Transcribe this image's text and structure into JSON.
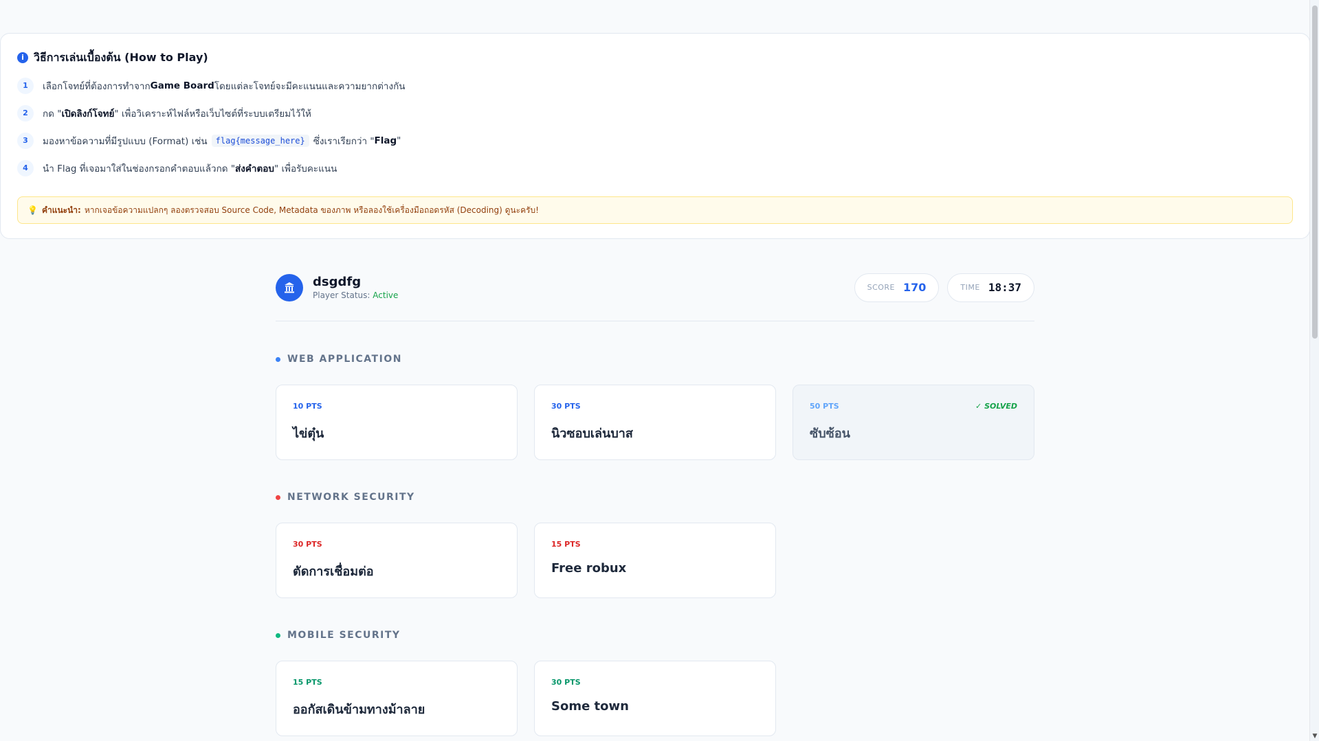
{
  "howto": {
    "title": "วิธีการเล่นเบื้องต้น (How to Play)",
    "steps": [
      {
        "num": "1",
        "pre": "เลือกโจทย์ที่ต้องการทำจาก ",
        "bold": "Game Board",
        "post": " โดยแต่ละโจทย์จะมีคะแนนและความยากต่างกัน"
      },
      {
        "num": "2",
        "pre": "กด \"",
        "bold": "เปิดลิงก์โจทย์",
        "post": "\" เพื่อวิเคราะห์ไฟล์หรือเว็บไซต์ที่ระบบเตรียมไว้ให้"
      },
      {
        "num": "3",
        "pre": "มองหาข้อความที่มีรูปแบบ (Format) เช่น",
        "code": "flag{message_here}",
        "mid": "ซึ่งเราเรียกว่า \"",
        "bold": "Flag",
        "post": "\""
      },
      {
        "num": "4",
        "pre": "นำ Flag ที่เจอมาใส่ในช่องกรอกคำตอบแล้วกด \"",
        "bold": "ส่งคำตอบ",
        "post": "\" เพื่อรับคะแนน"
      }
    ],
    "tip_label": "คำแนะนำ:",
    "tip_text": "หากเจอข้อความแปลกๆ ลองตรวจสอบ Source Code, Metadata ของภาพ หรือลองใช้เครื่องมือถอดรหัส (Decoding) ดูนะครับ!"
  },
  "player": {
    "name": "dsgdfg",
    "status_label": "Player Status:",
    "status_value": "Active",
    "score_label": "SCORE",
    "score_value": "170",
    "time_label": "TIME",
    "time_value": "18:37"
  },
  "categories": [
    {
      "name": "WEB APPLICATION",
      "color": "#3b82f6",
      "challenges": [
        {
          "pts": "10 PTS",
          "title": "ไข่ตุ๋น",
          "solved": false
        },
        {
          "pts": "30 PTS",
          "title": "นิวซอบเล่นบาส",
          "solved": false
        },
        {
          "pts": "50 PTS",
          "title": "ซับซ้อน",
          "solved": true,
          "solved_label": "SOLVED"
        }
      ]
    },
    {
      "name": "NETWORK SECURITY",
      "color": "#ef4444",
      "challenges": [
        {
          "pts": "30 PTS",
          "title": "ตัดการเชื่อมต่อ",
          "solved": false
        },
        {
          "pts": "15 PTS",
          "title": "Free robux",
          "solved": false
        }
      ]
    },
    {
      "name": "MOBILE SECURITY",
      "color": "#10b981",
      "challenges": [
        {
          "pts": "15 PTS",
          "title": "ออกัสเดินข้ามทางม้าลาย",
          "solved": false
        },
        {
          "pts": "30 PTS",
          "title": "Some town",
          "solved": false
        }
      ]
    }
  ],
  "icons": {
    "info": "info-icon",
    "tip": "lightbulb-icon",
    "avatar": "temple-icon",
    "check": "check-icon"
  }
}
